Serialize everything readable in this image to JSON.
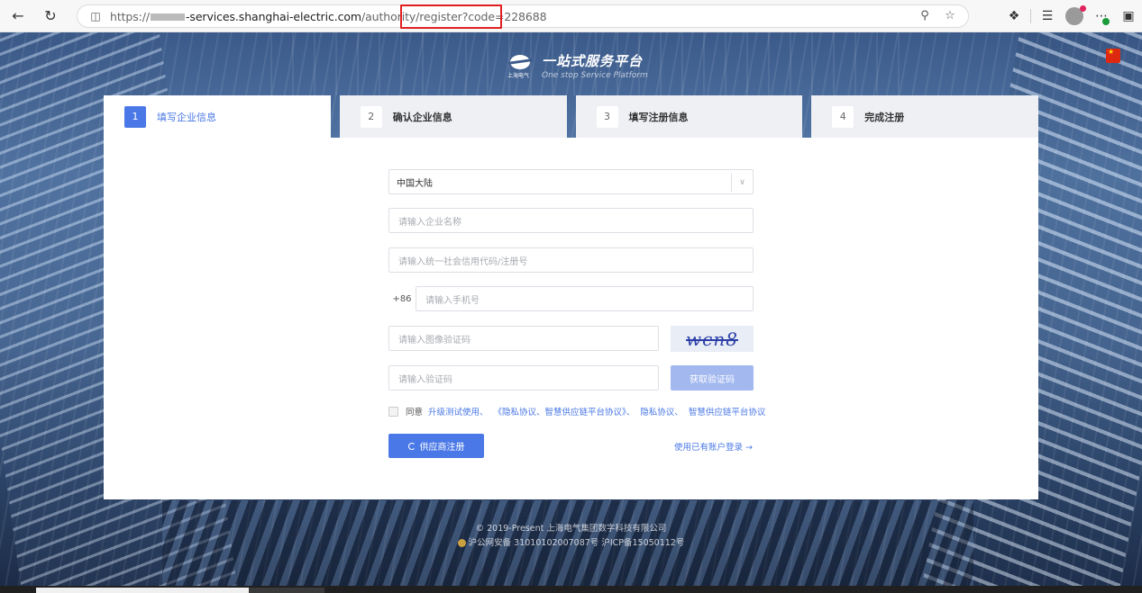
{
  "browser": {
    "url_prefix": "https://",
    "url_domain": "-services.shanghai-electric.com",
    "url_path": "/authority/register?code=228688"
  },
  "logo": {
    "title": "一站式服务平台",
    "subtitle": "One stop Service Platform",
    "brand": "上海电气"
  },
  "steps": [
    {
      "num": "1",
      "label": "填写企业信息"
    },
    {
      "num": "2",
      "label": "确认企业信息"
    },
    {
      "num": "3",
      "label": "填写注册信息"
    },
    {
      "num": "4",
      "label": "完成注册"
    }
  ],
  "form": {
    "region_value": "中国大陆",
    "company_name_placeholder": "请输入企业名称",
    "credit_code_placeholder": "请输入统一社会信用代码/注册号",
    "phone_prefix": "+86",
    "phone_placeholder": "请输入手机号",
    "captcha_placeholder": "请输入图像验证码",
    "captcha_text": "wcn8",
    "sms_placeholder": "请输入验证码",
    "sms_button": "获取验证码",
    "agree_prefix": "同意",
    "agree_link_1": "升级测试使用、",
    "agree_link_2": "《隐私协议、智慧供应链平台协议》、",
    "agree_link_3": "隐私协议、",
    "agree_link_4": "智慧供应链平台协议",
    "register_button": "供应商注册",
    "login_link": "使用已有账户登录 →"
  },
  "footer": {
    "copyright": "© 2019-Present 上海电气集团数字科技有限公司",
    "icp": "沪公网安备 31010102007087号 沪ICP备15050112号"
  },
  "colors": {
    "primary": "#4a78e6",
    "primary_disabled": "#a2b8ef",
    "highlight_box": "#e02020"
  }
}
